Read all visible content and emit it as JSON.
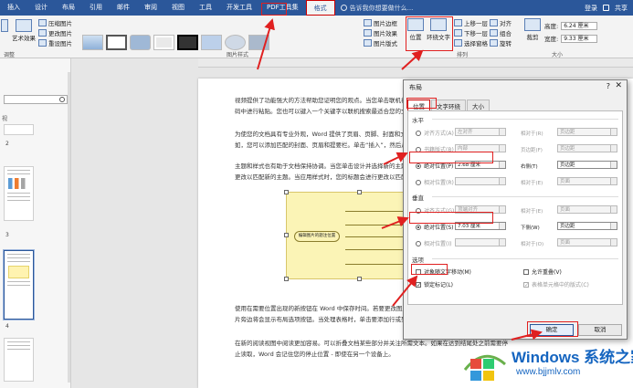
{
  "tabs": [
    "插入",
    "设计",
    "布局",
    "引用",
    "邮件",
    "审阅",
    "视图",
    "工具",
    "开发工具",
    "PDF工具集",
    "格式"
  ],
  "active_tab": "格式",
  "tell_me": "告诉我你想要做什么...",
  "account": {
    "login": "登录",
    "share": "共享"
  },
  "ribbon": {
    "adjust": {
      "label": "调整",
      "artistic": "艺术效果",
      "compress": "压缩图片",
      "change": "更改图片",
      "reset": "重设图片"
    },
    "styles_label": "图片样式",
    "picture_border": "图片边框",
    "picture_effects": "图片效果",
    "picture_layout": "图片版式",
    "arrange": {
      "label": "排列",
      "position": "位置",
      "wrap": "环绕文字",
      "forward": "上移一层",
      "backward": "下移一层",
      "selection": "选择窗格",
      "align": "对齐",
      "group": "组合",
      "rotate": "旋转"
    },
    "size": {
      "label": "大小",
      "crop": "裁剪",
      "height_label": "高度:",
      "height": "6.24 厘米",
      "width_label": "宽度:",
      "width": "9.33 厘米"
    }
  },
  "nav": {
    "heading": "视",
    "pages": [
      "2",
      "3",
      "4"
    ]
  },
  "doc": {
    "p1": "视频提供了功能强大的方法帮助您证明您的观点。当您单击联机视频时，可以在想要添加的视频的嵌入代码中进行粘贴。您也可以键入一个关键字以联机搜索最适合您的文档的视频。",
    "p2": "为使您的文档具有专业外观，Word 提供了页眉、页脚、封面和文本框设计，这些设计可互为补充。例如，您可以添加匹配的封面、页眉和提要栏。单击“插入”，然后从不同库中选择所需元素。",
    "p3": "主题和样式也有助于文档保持协调。当您单击设计并选择新的主题时，图片、图表或 SmartArt 图形将会更改以匹配新的主题。当应用样式时，您的标题会进行更改以匹配新的主题。",
    "p4": "使用在需要位置出现的新按钮在 Word 中保存时间。若要更改图片适应文档的方式，请单击该图片，图片旁边将会显示布局选项按钮。当处理表格时，单击要添加行或列的位置，然后单击加号。",
    "p5": "在新的阅读视图中阅读更加容易。可以折叠文档某些部分并关注所需文本。如果在达到结尾处之前需要停止读取，Word 会记住您的停止位置 - 即使在另一个设备上。",
    "mind_center": "编辑图片的题注位置"
  },
  "dialog": {
    "title": "布局",
    "help": "?",
    "close": "✕",
    "tabs": [
      "位置",
      "文字环绕",
      "大小"
    ],
    "horizontal": "水平",
    "h_align": "对齐方式(A)",
    "h_align_val": "左对齐",
    "h_rel1": "相对于(R)",
    "h_rel1_val": "页边距",
    "h_book": "书籍版式(B)",
    "h_book_val": "内部",
    "h_of": "页边距(F)",
    "h_abs": "绝对位置(P)",
    "h_abs_val": "2.68 厘米",
    "h_right": "右侧(T)",
    "h_right_val": "页边距",
    "h_rel": "相对位置(R)",
    "h_rel_to": "相对于(E)",
    "h_rel_val": "页面",
    "vertical": "垂直",
    "v_align": "对齐方式(G)",
    "v_align_val": "顶端对齐",
    "v_rel1": "相对于(E)",
    "v_rel1_val": "页面",
    "v_abs": "绝对位置(S)",
    "v_abs_val": "7.03 厘米",
    "v_below": "下侧(W)",
    "v_below_val": "页边距",
    "v_rel": "相对位置(I)",
    "v_rel_to": "相对于(O)",
    "v_rel_val": "页面",
    "options": "选项",
    "move_with_text": "对象随文字移动(M)",
    "lock_anchor": "锁定标记(L)",
    "allow_overlap": "允许重叠(V)",
    "layout_in_cell": "表格单元格中的版式(C)",
    "ok": "确定",
    "cancel": "取消"
  },
  "watermark": {
    "brand": "Windows 系统之家",
    "url": "www.bjjmlv.com"
  },
  "colors": {
    "accent": "#2b579a",
    "annotation": "#e02020",
    "mind_fill": "#fbf4b6",
    "watermark": "#1565c0"
  }
}
